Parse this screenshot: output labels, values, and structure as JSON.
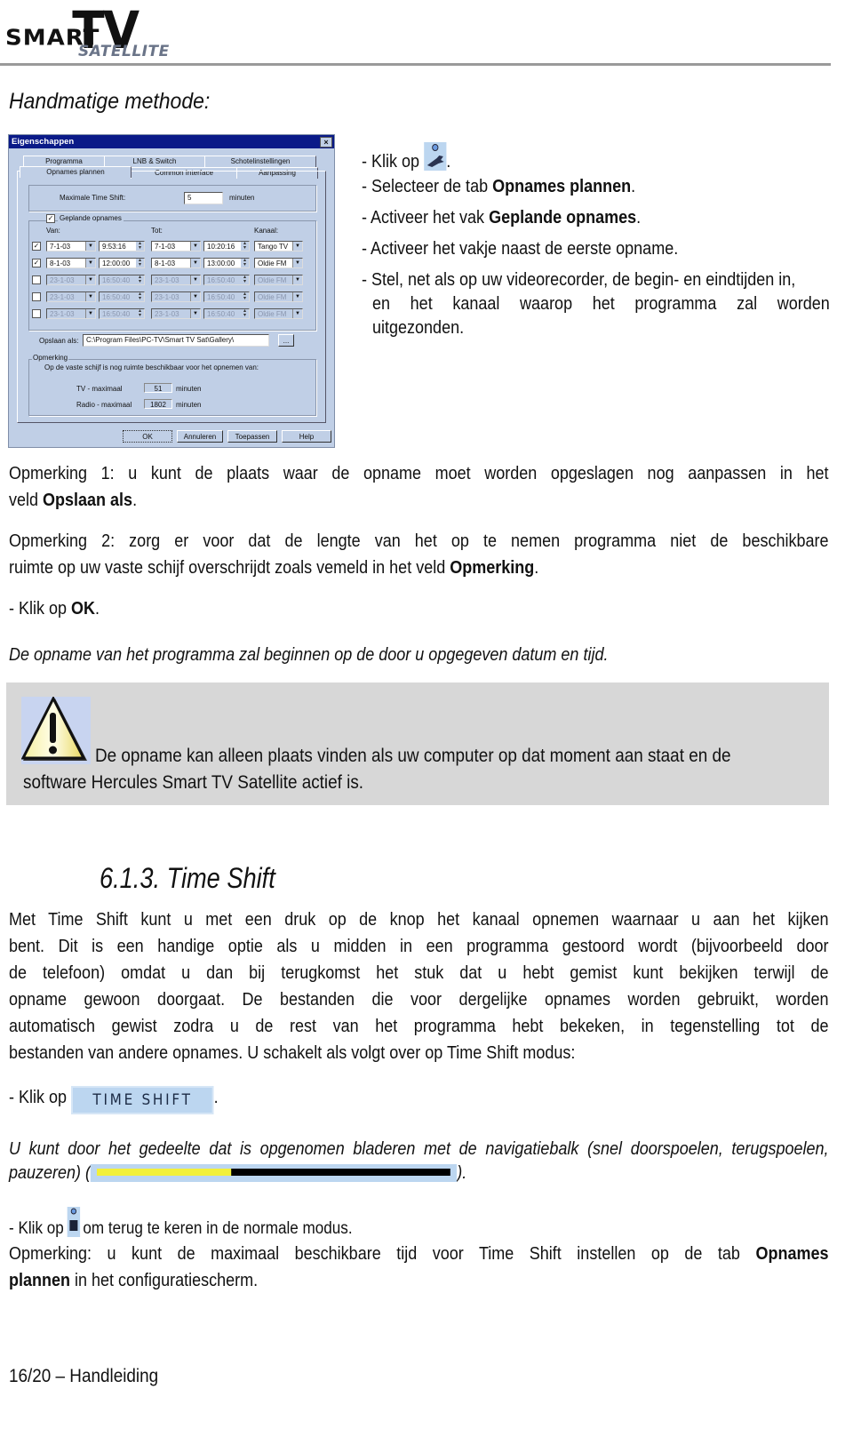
{
  "header": {
    "logo_smart": "SMART",
    "logo_tv": "TV",
    "logo_satellite": "SATELLITE"
  },
  "section_heading": "Handmatige methode:",
  "dialog": {
    "title": "Eigenschappen",
    "close_label": "×",
    "tabs_row1": [
      "Programma",
      "LNB & Switch",
      "Schotelinstellingen"
    ],
    "tabs_row2": [
      "Opnames plannen",
      "Common Interface",
      "Aanpassing"
    ],
    "active_tab": "Opnames plannen",
    "max_timeshift_label": "Maximale Time Shift:",
    "max_timeshift_value": "5",
    "max_timeshift_unit": "minuten",
    "scheduled_label": "Geplande opnames",
    "scheduled_checked": true,
    "col_from": "Van:",
    "col_to": "Tot:",
    "col_channel": "Kanaal:",
    "recordings": [
      {
        "checked": true,
        "enabled": true,
        "from_date": "7-1-03",
        "from_time": "9:53:16",
        "to_date": "7-1-03",
        "to_time": "10:20:16",
        "channel": "Tango TV"
      },
      {
        "checked": true,
        "enabled": true,
        "from_date": "8-1-03",
        "from_time": "12:00:00",
        "to_date": "8-1-03",
        "to_time": "13:00:00",
        "channel": "Oldie FM"
      },
      {
        "checked": false,
        "enabled": false,
        "from_date": "23-1-03",
        "from_time": "16:50:40",
        "to_date": "23-1-03",
        "to_time": "16:50:40",
        "channel": "Oldie FM"
      },
      {
        "checked": false,
        "enabled": false,
        "from_date": "23-1-03",
        "from_time": "16:50:40",
        "to_date": "23-1-03",
        "to_time": "16:50:40",
        "channel": "Oldie FM"
      },
      {
        "checked": false,
        "enabled": false,
        "from_date": "23-1-03",
        "from_time": "16:50:40",
        "to_date": "23-1-03",
        "to_time": "16:50:40",
        "channel": "Oldie FM"
      }
    ],
    "save_as_label": "Opslaan als:",
    "save_as_value": "C:\\Program Files\\PC-TV\\Smart TV Sat\\Gallery\\",
    "browse_label": "...",
    "remark_group": "Opmerking",
    "remark_text": "Op de vaste schijf is nog ruimte beschikbaar voor het opnemen van:",
    "tv_label": "TV  -  maximaal",
    "tv_value": "51",
    "radio_label": "Radio  -  maximaal",
    "radio_value": "1802",
    "unit": "minuten",
    "buttons": {
      "ok": "OK",
      "cancel": "Annuleren",
      "apply": "Toepassen",
      "help": "Help"
    }
  },
  "steps": {
    "s1_pre": "- Klik op ",
    "s1_post": ".",
    "s2_pre": "- Selecteer de tab ",
    "s2_bold": "Opnames plannen",
    "s2_post": ".",
    "s3_pre": "- Activeer het vak ",
    "s3_bold": "Geplande opnames",
    "s3_post": ".",
    "s4": "- Activeer het vakje naast de eerste opname.",
    "s5_line1": "- Stel, net als op uw videorecorder, de begin- en eindtijden in,",
    "s5_line2": "en het kanaal waarop het programma zal worden",
    "s5_line3": "uitgezonden."
  },
  "remark1": {
    "line1": "Opmerking 1: u kunt de plaats waar de opname moet worden opgeslagen nog aanpassen in het",
    "line2_pre": "veld ",
    "line2_bold": "Opslaan als",
    "line2_post": "."
  },
  "remark2": {
    "line1": "Opmerking 2: zorg er voor dat de lengte van het op te nemen programma niet de beschikbare",
    "line2_pre": "ruimte op uw vaste schijf overschrijdt zoals vemeld in het veld ",
    "line2_bold": "Opmerking",
    "line2_post": "."
  },
  "click_ok": {
    "pre": "- Klik op ",
    "bold": "OK",
    "post": "."
  },
  "italic_note": "De opname van het programma zal beginnen op de door u opgegeven datum en tijd.",
  "warning": {
    "line1": "De opname kan alleen plaats vinden als uw computer op dat moment aan staat en de",
    "line2": "software Hercules Smart TV Satellite actief is."
  },
  "timeshift": {
    "heading": "6.1.3. Time Shift",
    "para_lines": [
      "Met Time Shift kunt u met een druk op de knop het kanaal opnemen waarnaar u aan het kijken",
      "bent. Dit is een handige optie als u midden in een programma gestoord wordt (bijvoorbeeld door",
      "de telefoon) omdat u dan bij terugkomst het stuk dat u hebt gemist kunt bekijken terwijl de",
      "opname gewoon doorgaat. De bestanden die voor dergelijke opnames worden gebruikt, worden",
      "automatisch gewist zodra u de rest van het programma hebt bekeken, in tegenstelling tot de",
      "bestanden van andere opnames. U schakelt als volgt over op Time Shift modus:"
    ],
    "click_pre": "- Klik op",
    "button_label": "TIME SHIFT",
    "click_post": ".",
    "nav_line1": "U kunt door het gedeelte dat is opgenomen bladeren met de navigatiebalk (snel doorspoelen, terugspoelen,",
    "nav_line2_pre": "pauzeren) (",
    "nav_line2_post": ").",
    "nav_progress": 0.38,
    "back_pre": "- Klik op",
    "back_post": "om terug te keren in de normale modus.",
    "remark_line1_pre": "Opmerking: u kunt de maximaal beschikbare tijd voor Time Shift instellen op de tab ",
    "remark_line1_bold": "Opnames",
    "remark_line2_bold": "plannen",
    "remark_line2_post": " in het configuratiescherm."
  },
  "footer": "16/20 – Handleiding"
}
